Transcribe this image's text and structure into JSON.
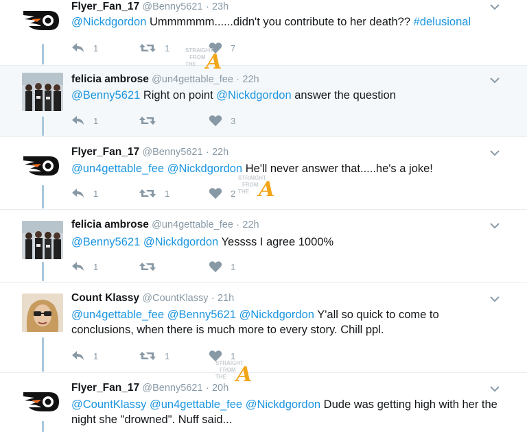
{
  "tweets": [
    {
      "name": "Flyer_Fan_17",
      "handle": "@Benny5621",
      "time": "23h",
      "body": [
        {
          "t": "@Nickdgordon",
          "link": true
        },
        {
          "t": " Ummmmmm......didn't you contribute to her death?? ",
          "link": false
        },
        {
          "t": "#delusional",
          "link": true
        }
      ],
      "reply_count": "1",
      "retweet_count": "1",
      "like_count": "7",
      "highlighted": false
    },
    {
      "name": "felicia ambrose",
      "handle": "@un4gettable_fee",
      "time": "22h",
      "body": [
        {
          "t": "@Benny5621",
          "link": true
        },
        {
          "t": " Right on point ",
          "link": false
        },
        {
          "t": "@Nickdgordon",
          "link": true
        },
        {
          "t": " answer the question",
          "link": false
        }
      ],
      "reply_count": "1",
      "retweet_count": "",
      "like_count": "3",
      "highlighted": true
    },
    {
      "name": "Flyer_Fan_17",
      "handle": "@Benny5621",
      "time": "22h",
      "body": [
        {
          "t": "@un4gettable_fee",
          "link": true
        },
        {
          "t": " ",
          "link": false
        },
        {
          "t": "@Nickdgordon",
          "link": true
        },
        {
          "t": " He'll never answer that.....he's a joke!",
          "link": false
        }
      ],
      "reply_count": "1",
      "retweet_count": "1",
      "like_count": "2",
      "highlighted": false
    },
    {
      "name": "felicia ambrose",
      "handle": "@un4gettable_fee",
      "time": "22h",
      "body": [
        {
          "t": "@Benny5621",
          "link": true
        },
        {
          "t": " ",
          "link": false
        },
        {
          "t": "@Nickdgordon",
          "link": true
        },
        {
          "t": " Yessss I agree 1000%",
          "link": false
        }
      ],
      "reply_count": "1",
      "retweet_count": "",
      "like_count": "1",
      "highlighted": false
    },
    {
      "name": "Count Klassy",
      "handle": "@CountKlassy",
      "time": "21h",
      "body": [
        {
          "t": "@un4gettable_fee",
          "link": true
        },
        {
          "t": " ",
          "link": false
        },
        {
          "t": "@Benny5621",
          "link": true
        },
        {
          "t": " ",
          "link": false
        },
        {
          "t": "@Nickdgordon",
          "link": true
        },
        {
          "t": " Y'all so quick to come to conclusions, when there is much more to every story. Chill ppl.",
          "link": false
        }
      ],
      "reply_count": "1",
      "retweet_count": "1",
      "like_count": "1",
      "highlighted": false
    },
    {
      "name": "Flyer_Fan_17",
      "handle": "@Benny5621",
      "time": "20h",
      "body": [
        {
          "t": "@CountKlassy",
          "link": true
        },
        {
          "t": " ",
          "link": false
        },
        {
          "t": "@un4gettable_fee",
          "link": true
        },
        {
          "t": " ",
          "link": false
        },
        {
          "t": "@Nickdgordon",
          "link": true
        },
        {
          "t": " Dude was getting high with her the night she \"drowned\". Nuff said...",
          "link": false
        }
      ],
      "reply_count": "",
      "retweet_count": "",
      "like_count": "",
      "highlighted": false
    }
  ],
  "watermark": {
    "line1": "STRAIGHT",
    "line2": "FROM",
    "line3": "THE",
    "letter": "A"
  },
  "meta_separator": "·",
  "colors": {
    "link": "#1b95e0",
    "meta": "#8899a6",
    "highlight_bg": "#f5f8fa",
    "thread_line": "#a9c7dc",
    "watermark": "#f2a516"
  },
  "icons": [
    "flyers-logo-icon",
    "reply-icon",
    "retweet-icon",
    "like-icon",
    "caret-down-icon"
  ]
}
